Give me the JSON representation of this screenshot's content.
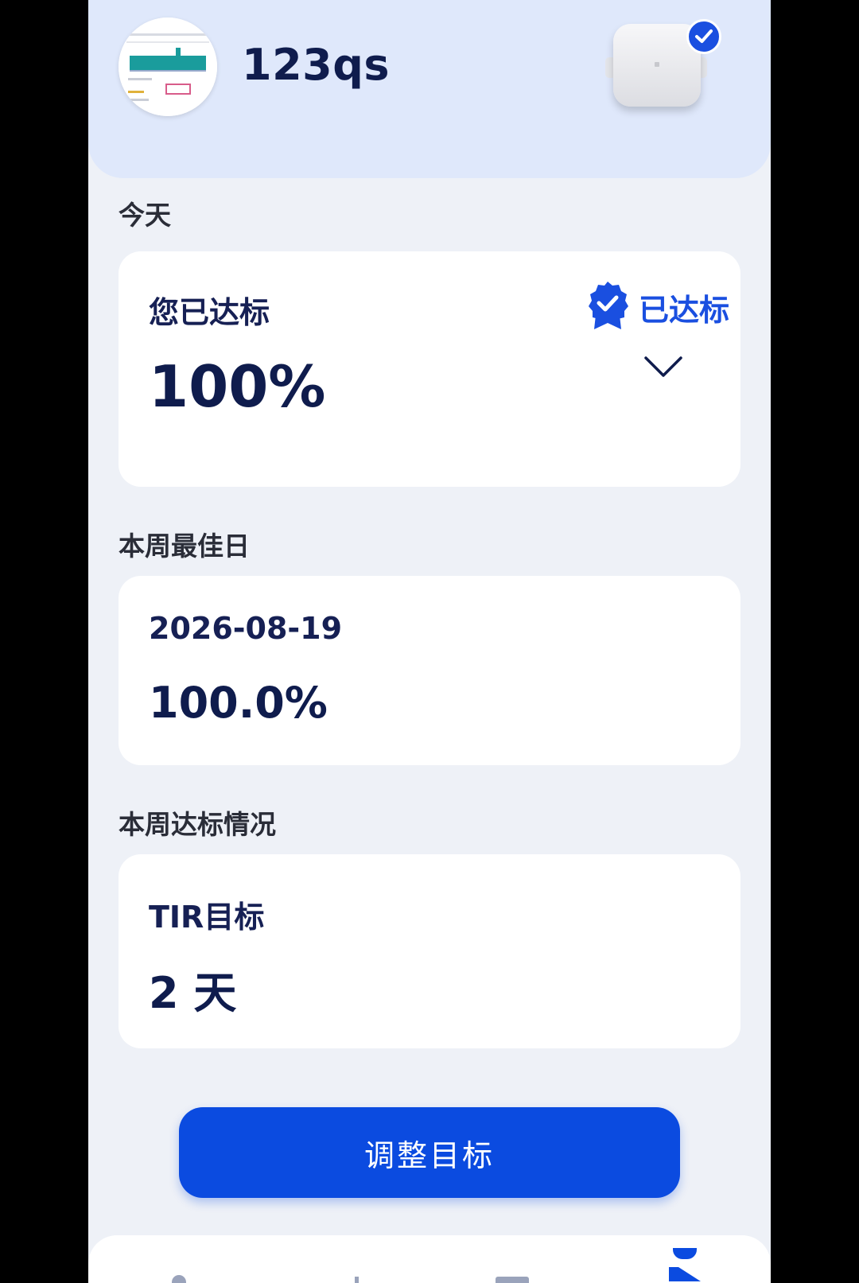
{
  "header": {
    "username": "123qs",
    "device_connected": true
  },
  "today": {
    "section_title": "今天",
    "status_label": "您已达标",
    "percent": "100%",
    "badge_label": "已达标"
  },
  "best_day": {
    "section_title": "本周最佳日",
    "date": "2026-08-19",
    "percent": "100.0%"
  },
  "weekly": {
    "section_title": "本周达标情况",
    "target_label": "TIR目标",
    "days": "2 天"
  },
  "actions": {
    "adjust_goal_label": "调整目标"
  },
  "colors": {
    "accent": "#0b4be0",
    "header_bg": "#dfe8fb",
    "page_bg": "#eef1f7",
    "text_dark": "#0f1c4d"
  },
  "icons": {
    "badge": "award-check-icon",
    "expand": "chevron-down-icon",
    "device": "sensor-device-icon"
  }
}
